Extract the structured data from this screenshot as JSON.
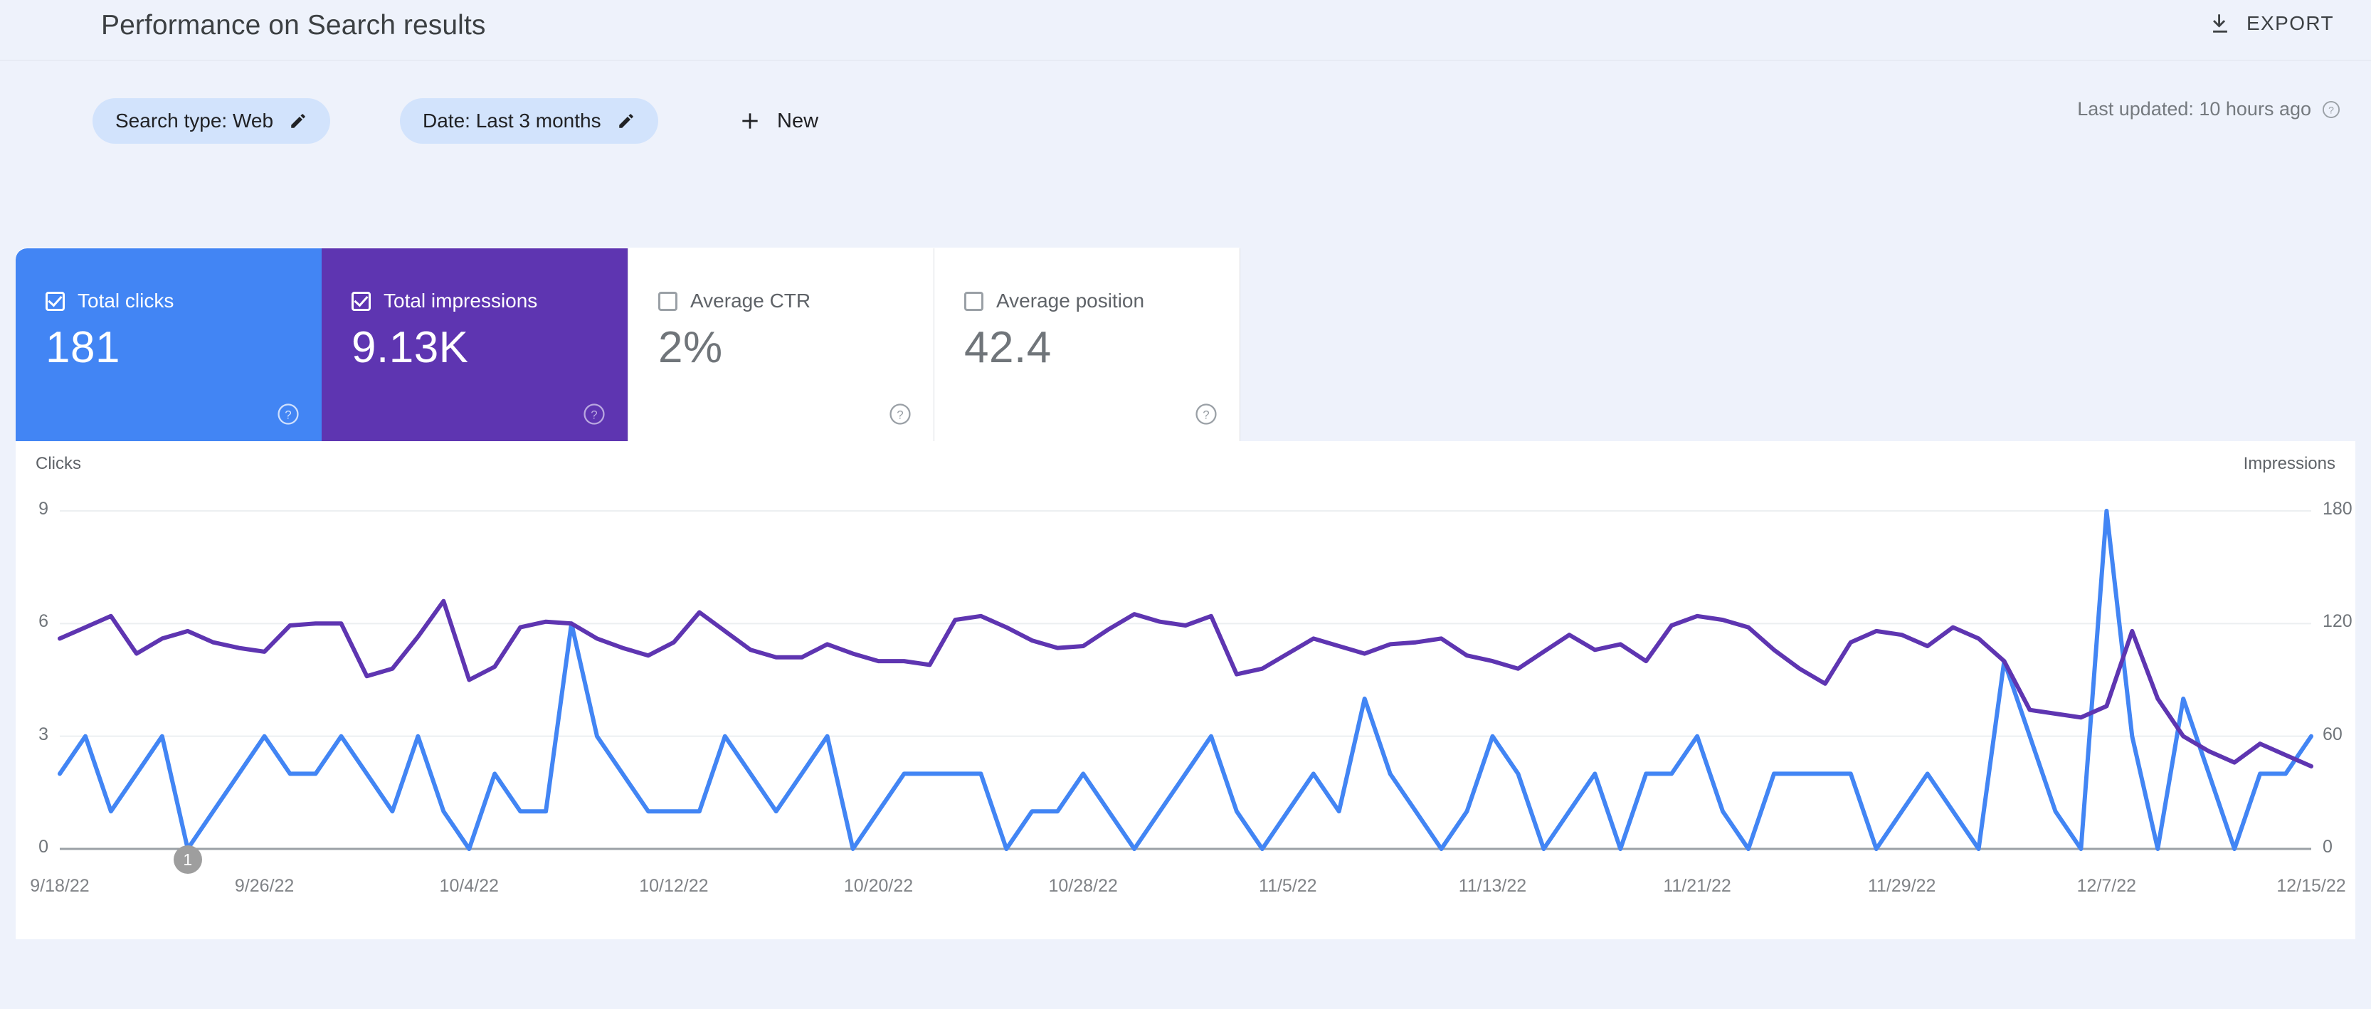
{
  "header": {
    "title": "Performance on Search results",
    "export_label": "EXPORT",
    "export_icon": "download-icon"
  },
  "filters": {
    "chips": [
      {
        "label": "Search type: Web",
        "edit_icon": "pencil-icon"
      },
      {
        "label": "Date: Last 3 months",
        "edit_icon": "pencil-icon"
      }
    ],
    "new_label": "New",
    "new_icon": "plus-icon",
    "last_updated": "Last updated: 10 hours ago",
    "last_updated_icon": "help-circle-icon"
  },
  "metric_cards": [
    {
      "title": "Total clicks",
      "value": "181",
      "checked": true,
      "color": "#4285f4",
      "help_icon": "help-circle-icon"
    },
    {
      "title": "Total impressions",
      "value": "9.13K",
      "checked": true,
      "color": "#5e35b1",
      "help_icon": "help-circle-icon"
    },
    {
      "title": "Average CTR",
      "value": "2%",
      "checked": false,
      "color": "#ffffff",
      "help_icon": "help-circle-icon"
    },
    {
      "title": "Average position",
      "value": "42.4",
      "checked": false,
      "color": "#ffffff",
      "help_icon": "help-circle-icon"
    }
  ],
  "annotation": {
    "label": "1"
  },
  "chart_data": {
    "type": "line",
    "title": "",
    "xlabel": "",
    "ylabel": "Clicks",
    "y2label": "Impressions",
    "grid": true,
    "legend": "none",
    "ylim": [
      0,
      9
    ],
    "y2lim": [
      0,
      180
    ],
    "yticks": [
      "0",
      "3",
      "6",
      "9"
    ],
    "y2ticks": [
      "0",
      "60",
      "120",
      "180"
    ],
    "xticks": [
      "9/18/22",
      "9/26/22",
      "10/4/22",
      "10/12/22",
      "10/20/22",
      "10/28/22",
      "11/5/22",
      "11/13/22",
      "11/21/22",
      "11/29/22",
      "12/7/22",
      "12/15/22"
    ],
    "x_start": "9/18/22",
    "x_end": "12/18/22",
    "n_points": 89,
    "series": [
      {
        "name": "Clicks",
        "color": "#4285f4",
        "axis": "left",
        "values": [
          2,
          3,
          1,
          2,
          3,
          0,
          1,
          2,
          3,
          2,
          2,
          3,
          2,
          1,
          3,
          1,
          0,
          2,
          1,
          1,
          6,
          3,
          2,
          1,
          1,
          1,
          3,
          2,
          1,
          2,
          3,
          0,
          1,
          2,
          2,
          2,
          2,
          0,
          1,
          1,
          2,
          1,
          0,
          1,
          2,
          3,
          1,
          0,
          1,
          2,
          1,
          4,
          2,
          1,
          0,
          1,
          3,
          2,
          0,
          1,
          2,
          0,
          2,
          2,
          3,
          1,
          0,
          2,
          2,
          2,
          2,
          0,
          1,
          2,
          1,
          0,
          5,
          3,
          1,
          0,
          9,
          3,
          0,
          4,
          2,
          0,
          2,
          2,
          3
        ]
      },
      {
        "name": "Impressions",
        "color": "#5e35b1",
        "axis": "right",
        "values": [
          112,
          118,
          124,
          104,
          112,
          116,
          110,
          107,
          105,
          119,
          120,
          120,
          92,
          96,
          113,
          132,
          90,
          97,
          118,
          121,
          120,
          112,
          107,
          103,
          110,
          126,
          116,
          106,
          102,
          102,
          109,
          104,
          100,
          100,
          98,
          122,
          124,
          118,
          111,
          107,
          108,
          117,
          125,
          121,
          119,
          124,
          93,
          96,
          104,
          112,
          108,
          104,
          109,
          110,
          112,
          103,
          100,
          96,
          105,
          114,
          106,
          109,
          100,
          119,
          124,
          122,
          118,
          106,
          96,
          88,
          110,
          116,
          114,
          108,
          118,
          112,
          100,
          74,
          72,
          70,
          76,
          116,
          80,
          60,
          52,
          46,
          56,
          50,
          44
        ]
      }
    ]
  }
}
